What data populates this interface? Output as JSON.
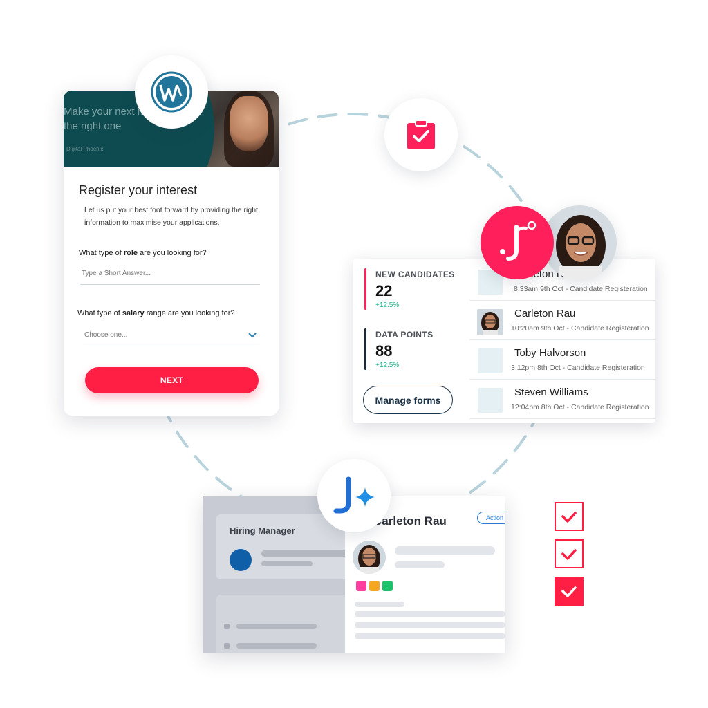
{
  "register_form": {
    "hero_headline_1": "Make your next m",
    "hero_headline_2": "the right one",
    "hero_brand": "Digital Phoenix",
    "title": "Register your interest",
    "description": "Let us put your best foot forward by providing the right information to maximise your applications.",
    "q1_pre": "What type of ",
    "q1_bold": "role",
    "q1_post": " are you looking for?",
    "q1_placeholder": "Type a Short Answer...",
    "q2_pre": "What type of ",
    "q2_bold": "salary",
    "q2_post": " range are you looking for?",
    "q2_placeholder": "Choose one...",
    "next_label": "NEXT"
  },
  "candidates": {
    "stats": [
      {
        "label": "NEW CANDIDATES",
        "value": "22",
        "change": "+12.5%",
        "color": "#ff1f5a"
      },
      {
        "label": "DATA POINTS",
        "value": "88",
        "change": "+12.5%",
        "color": "#1a2a3a"
      }
    ],
    "manage_label": "Manage forms",
    "rows": [
      {
        "name": "Carleton Rau",
        "meta": "8:33am 9th Oct - Candidate Registeration"
      },
      {
        "name": "Carleton Rau",
        "meta": "10:20am 9th Oct - Candidate Registeration"
      },
      {
        "name": "Toby Halvorson",
        "meta": "3:12pm 8th Oct  - Candidate Registeration"
      },
      {
        "name": "Steven Williams",
        "meta": "12:04pm 8th Oct - Candidate Registeration"
      }
    ]
  },
  "hiring": {
    "manager_title": "Hiring Manager",
    "candidate_name": "Carleton Rau",
    "action_label": "Action",
    "tag_colors": [
      "#ff3fa0",
      "#f5a623",
      "#1ec46b"
    ]
  },
  "colors": {
    "accent": "#ff1f45",
    "ring": "#b9d3dc",
    "wordpress": "#21759b",
    "jobadder_blue": "#1f6fd6"
  },
  "icons": {
    "wordpress": "wordpress-logo-icon",
    "clipboard": "clipboard-check-icon",
    "jf": "jf-logo-icon",
    "jplus": "j-sparkle-logo-icon",
    "checkbox": "checkbox-checked-icon"
  }
}
